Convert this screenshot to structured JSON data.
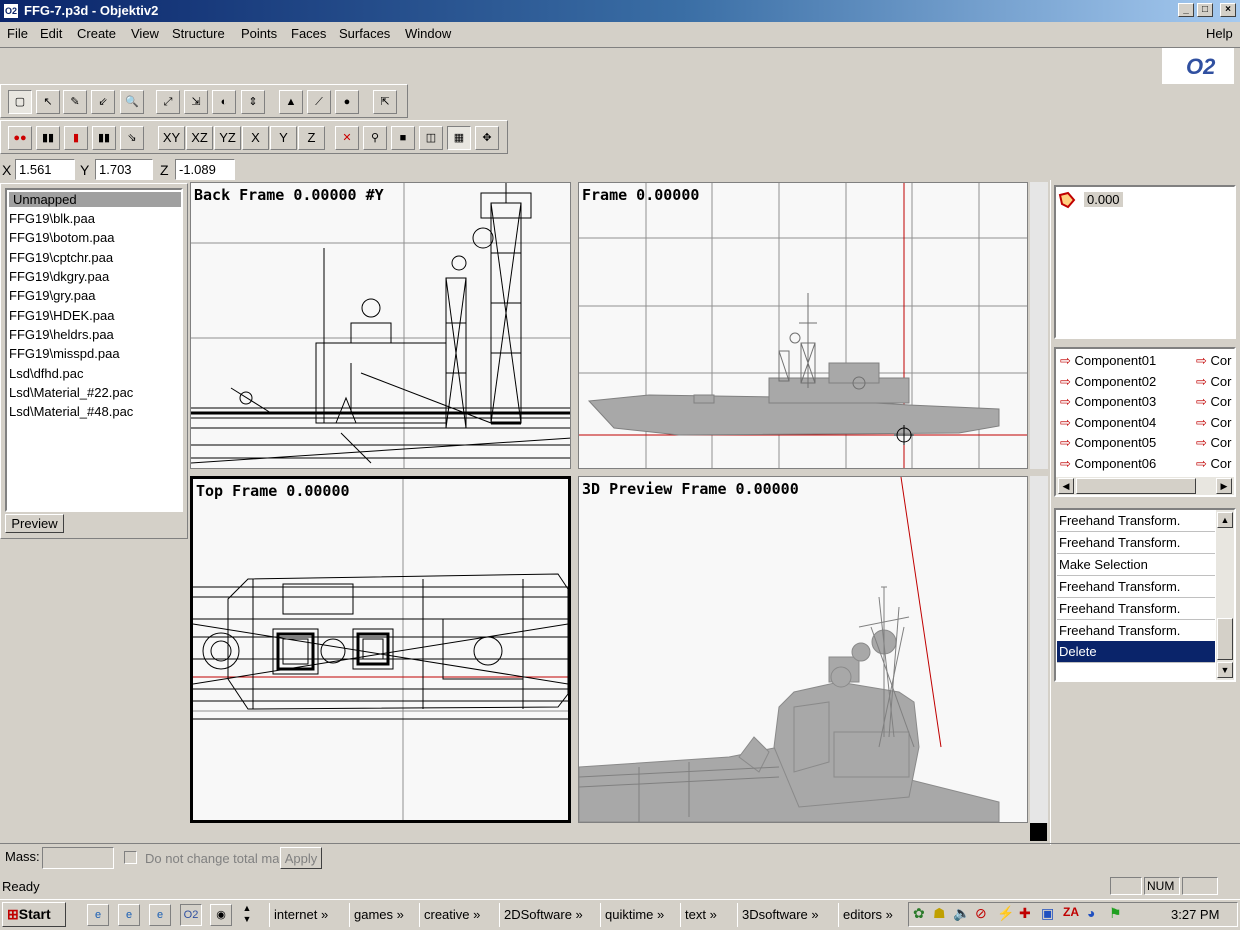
{
  "window": {
    "title": "FFG-7.p3d - Objektiv2",
    "app_icon": "objektiv-icon",
    "logo_text": "O2"
  },
  "menu": [
    "File",
    "Edit",
    "Create",
    "View",
    "Structure",
    "Points",
    "Faces",
    "Surfaces",
    "Window"
  ],
  "menu_help": "Help",
  "toolbar2": {
    "xy": "XY",
    "xz": "XZ",
    "yz": "YZ",
    "x": "X",
    "y": "Y",
    "z": "Z"
  },
  "coords": {
    "x_label": "X",
    "x_value": "1.561",
    "y_label": "Y",
    "y_value": "1.703",
    "z_label": "Z",
    "z_value": "-1.089"
  },
  "textures": {
    "items": [
      "Unmapped",
      "FFG19\\blk.paa",
      "FFG19\\botom.paa",
      "FFG19\\cptchr.paa",
      "FFG19\\dkgry.paa",
      "FFG19\\gry.paa",
      "FFG19\\HDEK.paa",
      "FFG19\\heldrs.paa",
      "FFG19\\misspd.paa",
      "Lsd\\dfhd.pac",
      "Lsd\\Material_#22.pac",
      "Lsd\\Material_#48.pac"
    ],
    "selected": "Unmapped",
    "preview_button": "Preview"
  },
  "viewports": {
    "back": "Back Frame 0.00000 #Y",
    "front": "Frame 0.00000",
    "top": "Top Frame 0.00000",
    "preview3d": "3D Preview Frame 0.00000"
  },
  "lod": {
    "value": "0.000"
  },
  "components": {
    "col1": [
      "Component01",
      "Component02",
      "Component03",
      "Component04",
      "Component05",
      "Component06"
    ],
    "col2": [
      "Cor",
      "Cor",
      "Cor",
      "Cor",
      "Cor",
      "Cor"
    ]
  },
  "history": [
    "Freehand Transform.",
    "Freehand Transform.",
    "Make Selection",
    "Freehand Transform.",
    "Freehand Transform.",
    "Freehand Transform.",
    "Delete"
  ],
  "mass": {
    "label": "Mass:",
    "value": "",
    "checkbox_label": "Do not change total ma",
    "apply_button": "Apply"
  },
  "status": {
    "text": "Ready",
    "num": "NUM"
  },
  "taskbar": {
    "start": "Start",
    "groups": [
      "internet",
      "games",
      "creative",
      "2DSoftware",
      "quiktime",
      "text",
      "3Dsoftware",
      "editors"
    ],
    "more": "»",
    "clock": "3:27 PM"
  },
  "colors": {
    "titlebar": "#0a246a",
    "selection": "#0a246a",
    "axis": "#c00000"
  }
}
